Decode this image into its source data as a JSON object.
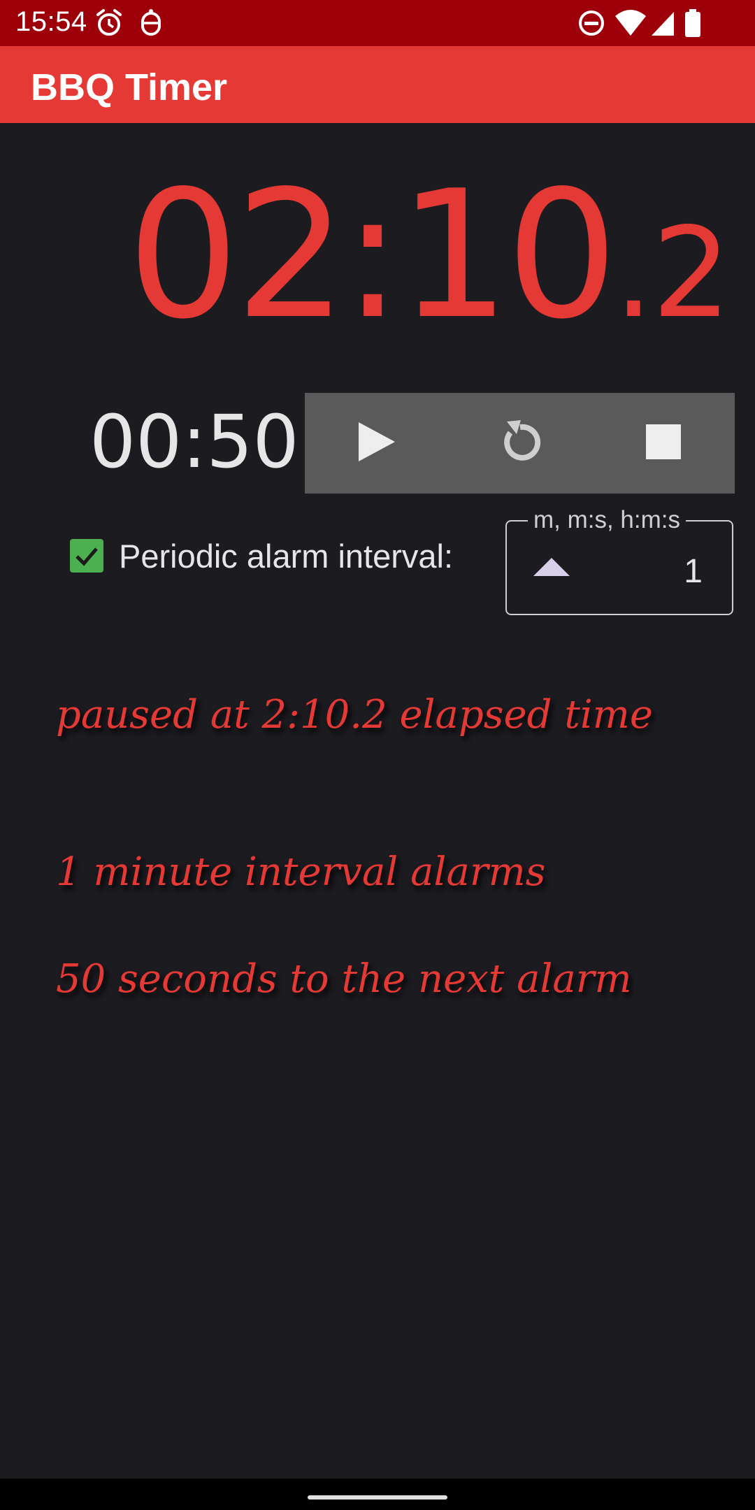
{
  "status_bar": {
    "time": "15:54",
    "icons": [
      "alarm-clock-icon",
      "notification-icon",
      "do-not-disturb-icon",
      "wifi-icon",
      "cellular-signal-icon",
      "battery-icon"
    ]
  },
  "app_bar": {
    "title": "BBQ Timer"
  },
  "timer": {
    "elapsed_main": "02:10",
    "elapsed_fraction": ".2",
    "countdown": "00:50"
  },
  "controls": {
    "icons": [
      "play-icon",
      "reset-icon",
      "stop-icon"
    ]
  },
  "periodic_alarm": {
    "checked": true,
    "label": "Periodic alarm interval:",
    "field_label": "m, m:s, h:m:s",
    "value": "1"
  },
  "status_messages": [
    "paused at 2:10.2 elapsed time",
    "1 minute interval alarms",
    "50 seconds to the next alarm"
  ],
  "colors": {
    "status_bar": "#9e0009",
    "app_bar": "#e53935",
    "accent": "#e53935",
    "background": "#1c1b20",
    "controls_bg": "#5a5a5a",
    "checkbox": "#4caf50"
  }
}
